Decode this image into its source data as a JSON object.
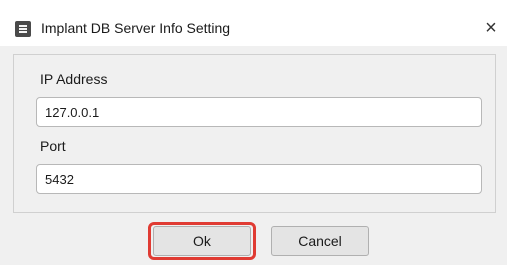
{
  "dialog": {
    "title": "Implant DB Server Info Setting",
    "icon": "database-icon",
    "close_label": "×"
  },
  "form": {
    "ip_label": "IP Address",
    "ip_value": "127.0.0.1",
    "port_label": "Port",
    "port_value": "5432"
  },
  "buttons": {
    "ok_label": "Ok",
    "cancel_label": "Cancel"
  },
  "colors": {
    "highlight": "#e03b33",
    "window_bg": "#f0f0f0"
  }
}
